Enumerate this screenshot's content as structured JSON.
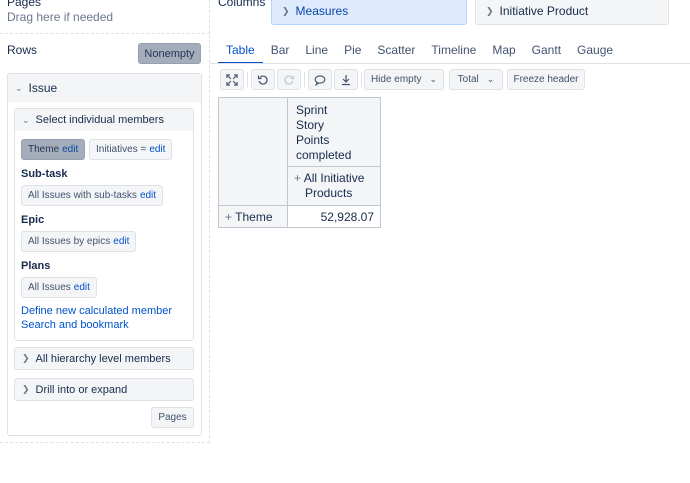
{
  "pages": {
    "title": "Pages",
    "hint": "Drag here if needed"
  },
  "columns": {
    "title": "Columns",
    "chips": [
      {
        "label": "Measures"
      },
      {
        "label": "Initiative Product"
      }
    ]
  },
  "rows": {
    "title": "Rows",
    "nonempty_label": "Nonempty",
    "dimension": "Issue",
    "select_members": {
      "title": "Select individual members",
      "theme_chip": {
        "label": "Theme",
        "edit": "edit"
      },
      "initiatives_chip": {
        "label": "Initiatives =",
        "edit": "edit"
      },
      "subtask": {
        "label": "Sub-task",
        "chip": "All Issues with sub-tasks",
        "edit": "edit"
      },
      "epic": {
        "label": "Epic",
        "chip": "All Issues by epics",
        "edit": "edit"
      },
      "plans": {
        "label": "Plans",
        "chip": "All Issues",
        "edit": "edit"
      },
      "define_link": "Define new calculated member",
      "search_link": "Search and bookmark"
    },
    "all_hierarchy": "All hierarchy level members",
    "drill": "Drill into or expand",
    "pages_button": "Pages"
  },
  "tabs": [
    {
      "label": "Table",
      "active": true
    },
    {
      "label": "Bar"
    },
    {
      "label": "Line"
    },
    {
      "label": "Pie"
    },
    {
      "label": "Scatter"
    },
    {
      "label": "Timeline"
    },
    {
      "label": "Map"
    },
    {
      "label": "Gantt"
    },
    {
      "label": "Gauge"
    }
  ],
  "toolbar": {
    "hide_empty": "Hide empty",
    "total": "Total",
    "freeze_header": "Freeze header"
  },
  "table": {
    "measure_header": [
      "Sprint",
      "Story",
      "Points",
      "completed"
    ],
    "column_member": [
      "All Initiative",
      "Products"
    ],
    "row_member": "Theme",
    "value": "52,928.07"
  }
}
